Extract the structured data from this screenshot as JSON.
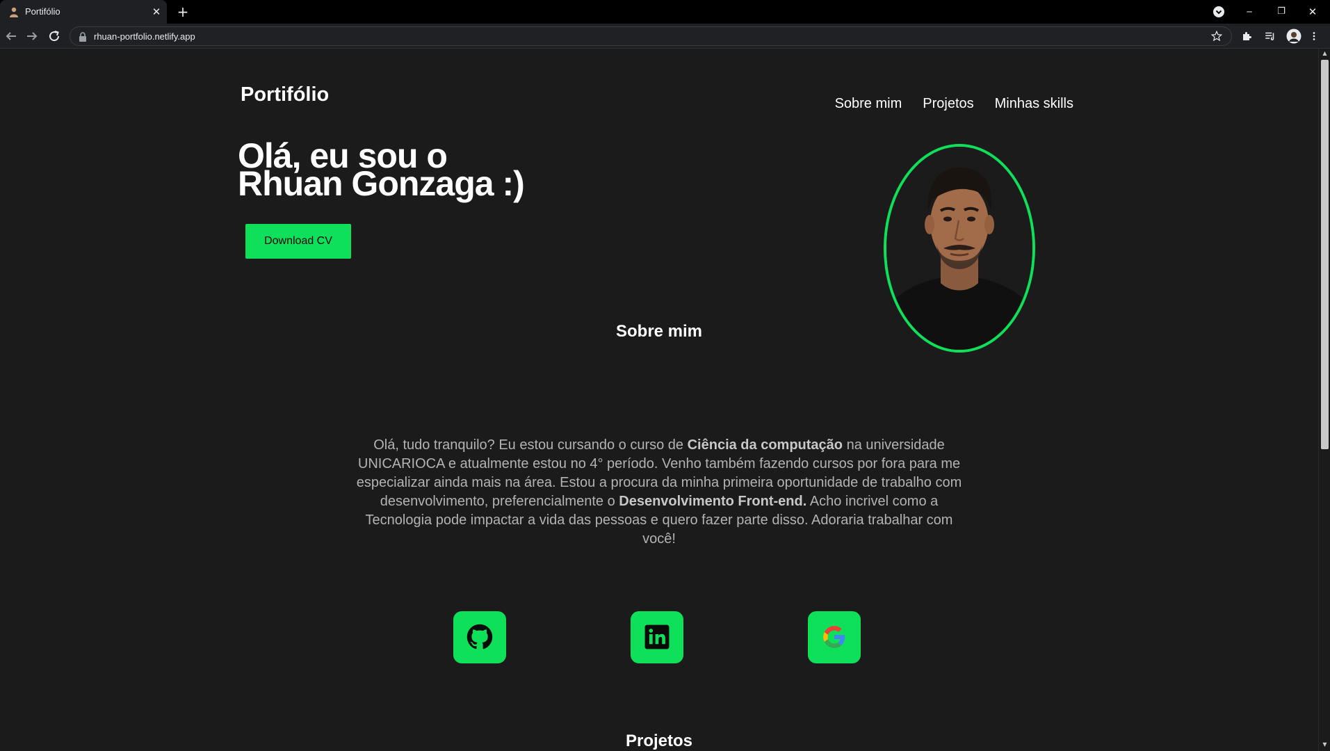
{
  "browser": {
    "tab_title": "Portifólio",
    "tab_close": "✕",
    "new_tab": "+",
    "url": "rhuan-portfolio.netlify.app",
    "window_minimize": "─",
    "window_restore": "❐",
    "window_close": "✕"
  },
  "header": {
    "brand": "Portifólio",
    "nav": [
      "Sobre mim",
      "Projetos",
      "Minhas skills"
    ]
  },
  "hero": {
    "title_line1": "Olá, eu sou o",
    "title_line2": "Rhuan Gonzaga :)",
    "download_label": "Download CV"
  },
  "about": {
    "title": "Sobre mim",
    "p1": "Olá, tudo tranquilo? Eu estou cursando o curso de ",
    "b1": "Ciência da computação",
    "p2": " na universidade UNICARIOCA e atualmente estou no 4° período. Venho também fazendo cursos por fora para me especializar ainda mais na área. Estou a procura da minha primeira oportunidade de trabalho com desenvolvimento, preferencialmente o ",
    "b2": "Desenvolvimento Front-end.",
    "p3": " Acho incrivel como a Tecnologia pode impactar a vida das pessoas e quero fazer parte disso. Adoraria trabalhar com você!"
  },
  "social": {
    "icons": [
      "github-icon",
      "linkedin-icon",
      "google-icon"
    ]
  },
  "projects": {
    "title": "Projetos"
  },
  "colors": {
    "accent": "#0ee05a",
    "background": "#1b1b1b"
  }
}
